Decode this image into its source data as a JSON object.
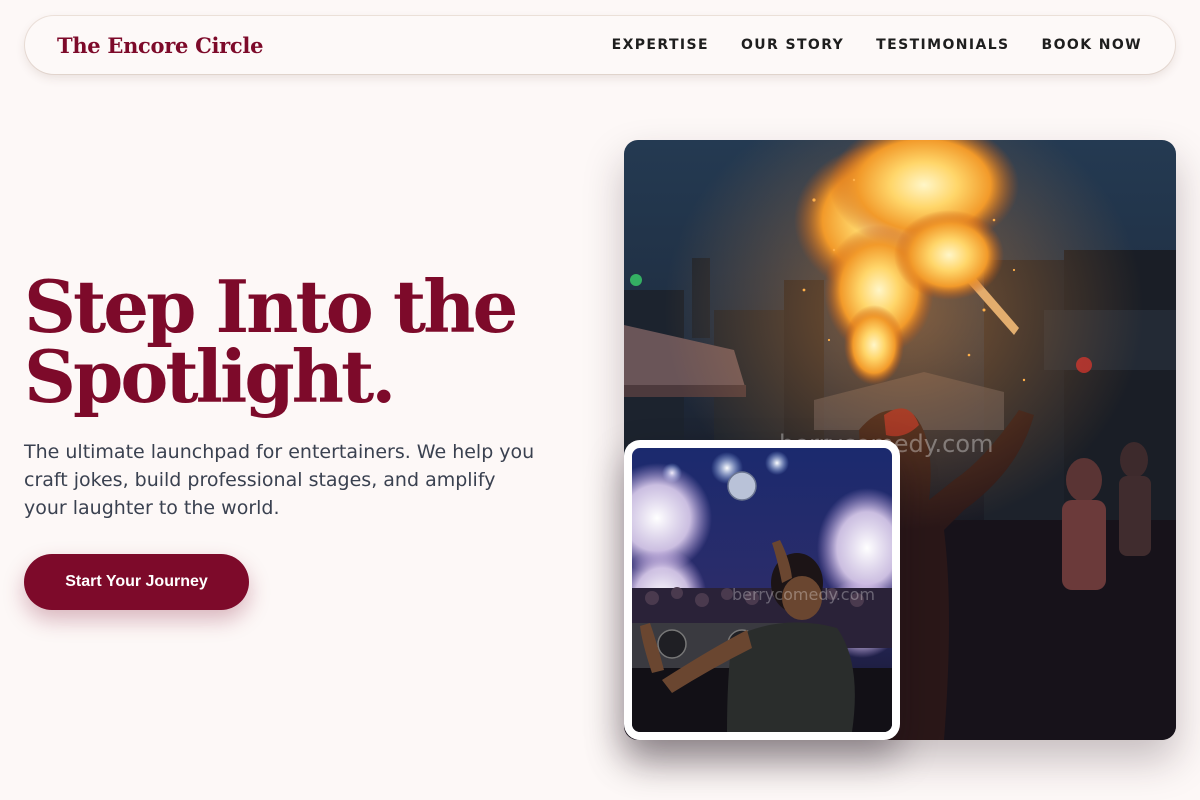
{
  "brand": {
    "name": "The Encore Circle"
  },
  "nav": {
    "items": [
      {
        "label": "EXPERTISE"
      },
      {
        "label": "OUR STORY"
      },
      {
        "label": "TESTIMONIALS"
      },
      {
        "label": "BOOK NOW"
      }
    ]
  },
  "hero": {
    "title_line1": "Step Into the",
    "title_line2": "Spotlight.",
    "subtitle": "The ultimate launchpad for entertainers. We help you craft jokes, build professional stages, and amplify your laughter to the world.",
    "cta_label": "Start Your Journey"
  },
  "images": {
    "main": {
      "watermark": "berrycomedy.com"
    },
    "inset": {
      "watermark": "berrycomedy.com"
    }
  },
  "colors": {
    "accent": "#7d0a2a",
    "background": "#fdf8f7",
    "text": "#3a4150"
  }
}
